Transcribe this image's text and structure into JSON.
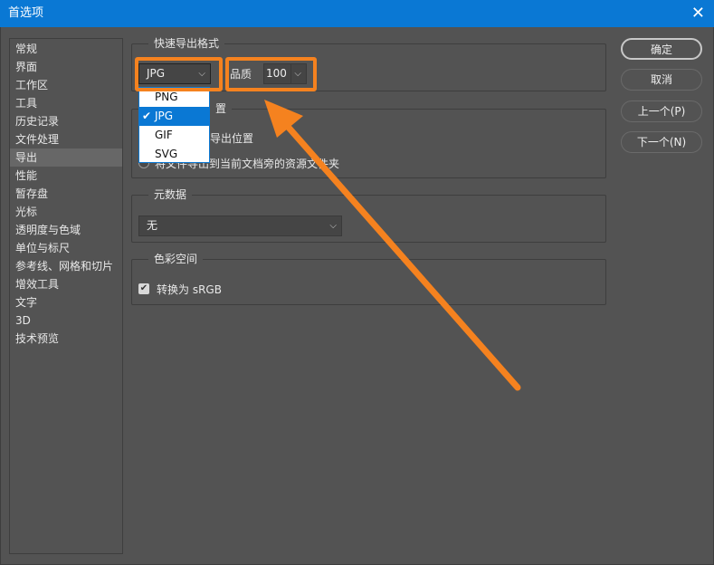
{
  "window": {
    "title": "首选项",
    "close_icon": "close-icon"
  },
  "sidebar": {
    "items": [
      "常规",
      "界面",
      "工作区",
      "工具",
      "历史记录",
      "文件处理",
      "导出",
      "性能",
      "暂存盘",
      "光标",
      "透明度与色域",
      "单位与标尺",
      "参考线、网格和切片",
      "增效工具",
      "文字",
      "3D",
      "技术预览"
    ],
    "selected": "导出"
  },
  "quick_export": {
    "legend": "快速导出格式",
    "format_value": "JPG",
    "quality_label": "品质",
    "quality_value": "100",
    "format_options": [
      {
        "label": "PNG"
      },
      {
        "label": "JPG",
        "checked": true
      },
      {
        "label": "GIF"
      },
      {
        "label": "SVG"
      }
    ]
  },
  "location": {
    "legend_fragment": "置",
    "option1_fragment": "导出位置",
    "option2": "将文件导出到当前文档旁的资源文件夹"
  },
  "metadata": {
    "legend": "元数据",
    "value": "无"
  },
  "color_space": {
    "legend": "色彩空间",
    "checkbox_label": "转换为 sRGB",
    "checked": true
  },
  "buttons": {
    "ok": "确定",
    "cancel": "取消",
    "prev": "上一个(P)",
    "next": "下一个(N)"
  },
  "annotation_color": "#f5821f",
  "accent_color": "#0a78d4"
}
